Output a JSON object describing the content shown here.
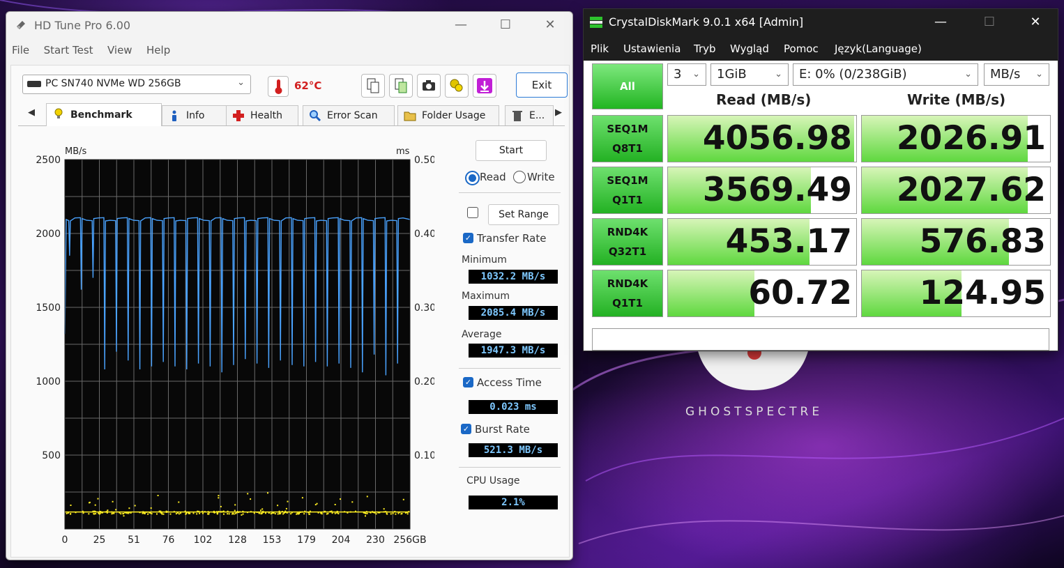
{
  "wallpaper": {
    "brand": "GHOSTSPECTRE"
  },
  "hdtune": {
    "title": "HD Tune Pro 6.00",
    "window_controls": {
      "minimize": "—",
      "maximize": "☐",
      "close": "✕"
    },
    "menu": [
      "File",
      "Start Test",
      "View",
      "Help"
    ],
    "device": "PC SN740 NVMe WD 256GB",
    "temperature": "62°C",
    "exit_label": "Exit",
    "tabs": [
      "Benchmark",
      "Info",
      "Health",
      "Error Scan",
      "Folder Usage",
      "E..."
    ],
    "start_label": "Start",
    "read_label": "Read",
    "write_label": "Write",
    "mode_selected": "Read",
    "set_range_label": "Set Range",
    "transfer_rate_label": "Transfer Rate",
    "minimum_label": "Minimum",
    "minimum": "1032.2 MB/s",
    "maximum_label": "Maximum",
    "maximum": "2085.4 MB/s",
    "average_label": "Average",
    "average": "1947.3 MB/s",
    "access_time_label": "Access Time",
    "access_time": "0.023 ms",
    "burst_rate_label": "Burst Rate",
    "burst_rate": "521.3 MB/s",
    "cpu_usage_label": "CPU Usage",
    "cpu_usage": "2.1%",
    "colors": {
      "transfer_line": "#4aa3ff",
      "access_dots": "#ffee22",
      "lcd_text": "#7ec8ff",
      "temp": "#d21f1f"
    }
  },
  "chart_data": {
    "type": "line",
    "y_left_unit": "MB/s",
    "y_right_unit": "ms",
    "ylim_left": [
      0,
      2500
    ],
    "ylim_right": [
      0,
      0.5
    ],
    "y_left_ticks": [
      "2500",
      "2000",
      "1500",
      "1000",
      "500"
    ],
    "y_right_ticks": [
      "0.50",
      "0.40",
      "0.30",
      "0.20",
      "0.10"
    ],
    "x_ticks": [
      "0",
      "25",
      "51",
      "76",
      "102",
      "128",
      "153",
      "179",
      "204",
      "230",
      "256GB"
    ],
    "xlim": [
      0,
      256
    ],
    "grid": true,
    "series": [
      {
        "kind": "transfer_rate",
        "baseline": 2095,
        "dip_count": 29,
        "dip_depths": [
          1850,
          1620,
          1700,
          1080,
          1200,
          1140,
          1080,
          1100,
          1130,
          1100,
          1080,
          1120,
          1100,
          1060,
          1110,
          1150,
          1120,
          1090,
          1140,
          1110,
          1100,
          1130,
          1100,
          1120,
          1090,
          1060,
          1180,
          1040,
          1120
        ]
      },
      {
        "kind": "access_time",
        "typical_ms": 0.023,
        "spread_ms": [
          0.018,
          0.05
        ]
      }
    ]
  },
  "crystaldiskmark": {
    "title": "CrystalDiskMark 9.0.1 x64 [Admin]",
    "window_controls": {
      "minimize": "—",
      "maximize": "☐",
      "close": "✕"
    },
    "menu": [
      "Plik",
      "Ustawienia",
      "Tryb",
      "Wygląd",
      "Pomoc",
      "Język(Language)"
    ],
    "all_label": "All",
    "runs": "3",
    "size": "1GiB",
    "drive": "E: 0% (0/238GiB)",
    "unit": "MB/s",
    "read_header": "Read (MB/s)",
    "write_header": "Write (MB/s)",
    "tests": [
      {
        "line1": "SEQ1M",
        "line2": "Q8T1",
        "read": "4056.98",
        "write": "2026.91",
        "read_fill": 0.99,
        "write_fill": 0.88
      },
      {
        "line1": "SEQ1M",
        "line2": "Q1T1",
        "read": "3569.49",
        "write": "2027.62",
        "read_fill": 0.76,
        "write_fill": 0.88
      },
      {
        "line1": "RND4K",
        "line2": "Q32T1",
        "read": "453.17",
        "write": "576.83",
        "read_fill": 0.75,
        "write_fill": 0.78
      },
      {
        "line1": "RND4K",
        "line2": "Q1T1",
        "read": "60.72",
        "write": "124.95",
        "read_fill": 0.46,
        "write_fill": 0.53
      }
    ]
  }
}
